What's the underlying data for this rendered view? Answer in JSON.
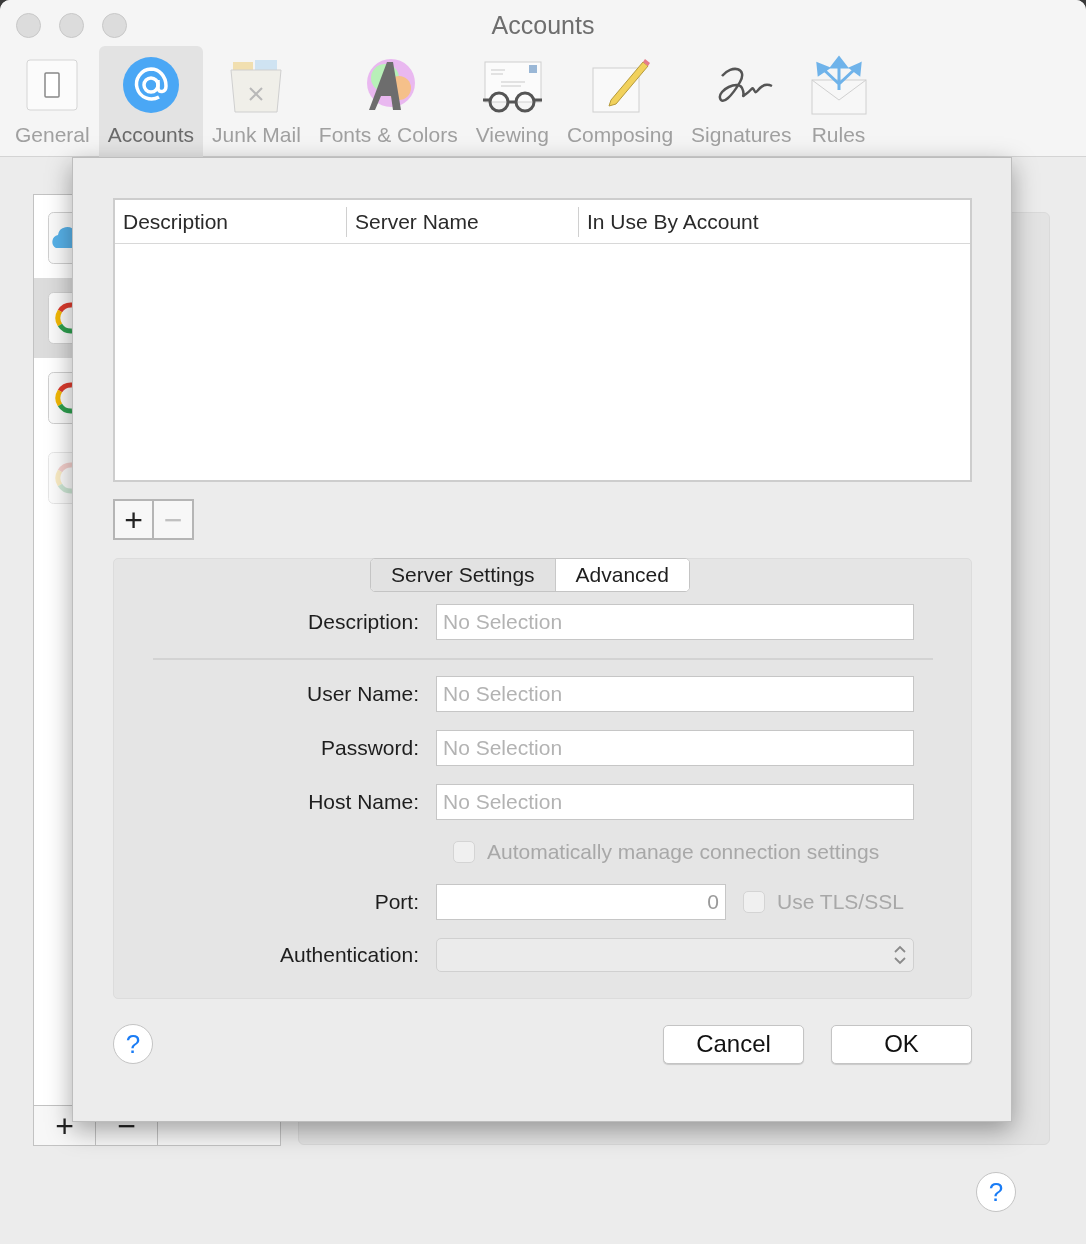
{
  "window": {
    "title": "Accounts"
  },
  "toolbar": [
    {
      "label": "General",
      "kind": "switch",
      "selected": false
    },
    {
      "label": "Accounts",
      "kind": "at",
      "selected": true
    },
    {
      "label": "Junk Mail",
      "kind": "trash",
      "selected": false
    },
    {
      "label": "Fonts & Colors",
      "kind": "font",
      "selected": false
    },
    {
      "label": "Viewing",
      "kind": "glasses",
      "selected": false
    },
    {
      "label": "Composing",
      "kind": "pencil",
      "selected": false
    },
    {
      "label": "Signatures",
      "kind": "signature",
      "selected": false
    },
    {
      "label": "Rules",
      "kind": "rules",
      "selected": false
    }
  ],
  "sidebar": {
    "accounts": [
      {
        "kind": "cloud",
        "selected": false,
        "disabled": false
      },
      {
        "kind": "ring",
        "selected": true,
        "disabled": false
      },
      {
        "kind": "ring",
        "selected": false,
        "disabled": false
      },
      {
        "kind": "ring",
        "selected": false,
        "disabled": true
      }
    ],
    "add_button": {
      "label": "+"
    },
    "remove_button": {
      "label": "−"
    }
  },
  "sheet": {
    "table": {
      "columns": [
        "Description",
        "Server Name",
        "In Use By Account"
      ]
    },
    "add_button": {
      "label": "+",
      "disabled": false
    },
    "remove_button": {
      "label": "−",
      "disabled": true
    },
    "tabs": [
      {
        "label": "Server Settings",
        "selected": true
      },
      {
        "label": "Advanced",
        "selected": false
      }
    ],
    "fields": [
      {
        "kind": "text",
        "label": "Description:",
        "placeholder": "No Selection"
      },
      {
        "kind": "separator"
      },
      {
        "kind": "text",
        "label": "User Name:",
        "placeholder": "No Selection"
      },
      {
        "kind": "text",
        "label": "Password:",
        "placeholder": "No Selection"
      },
      {
        "kind": "text",
        "label": "Host Name:",
        "placeholder": "No Selection"
      },
      {
        "kind": "checkbox",
        "label": "Automatically manage connection settings",
        "checked": false,
        "disabled": true
      },
      {
        "kind": "port",
        "label": "Port:",
        "value": "0",
        "checkbox": {
          "label": "Use TLS/SSL",
          "checked": false,
          "disabled": true
        }
      },
      {
        "kind": "popup",
        "label": "Authentication:",
        "disabled": true
      }
    ],
    "help_button": {
      "label": "?"
    },
    "buttons": [
      "Cancel",
      "OK"
    ]
  },
  "help_button": {
    "label": "?"
  }
}
